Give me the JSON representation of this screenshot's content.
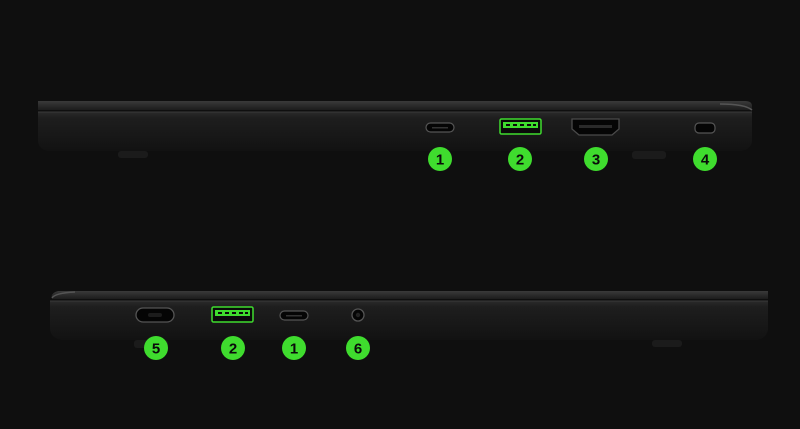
{
  "colors": {
    "background": "#0f0f0f",
    "badge": "#3fdc2e",
    "usb_a_port": "#3fdc2e",
    "laptop_body": "#1a1a1a"
  },
  "right_side_view": {
    "ports": [
      {
        "icon": "usb-c-port-icon",
        "number": "1"
      },
      {
        "icon": "usb-a-port-icon",
        "number": "2"
      },
      {
        "icon": "hdmi-port-icon",
        "number": "3"
      },
      {
        "icon": "security-lock-slot-icon",
        "number": "4"
      }
    ]
  },
  "left_side_view": {
    "ports": [
      {
        "icon": "power-port-icon",
        "number": "5"
      },
      {
        "icon": "usb-a-port-icon",
        "number": "2"
      },
      {
        "icon": "usb-c-port-icon",
        "number": "1"
      },
      {
        "icon": "audio-jack-icon",
        "number": "6"
      }
    ]
  }
}
